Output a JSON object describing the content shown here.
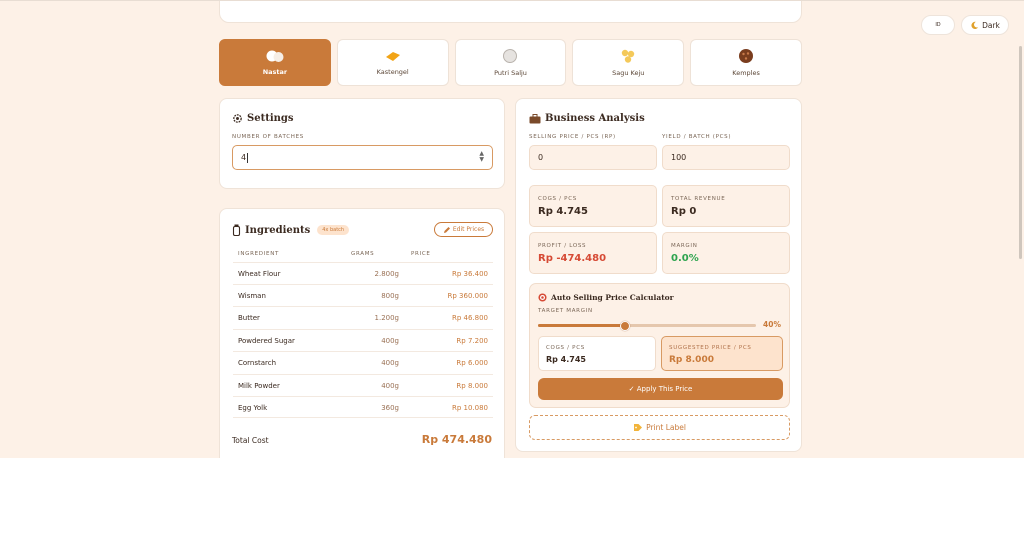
{
  "top_bar": {
    "lang_flag": "ID",
    "lang_label": "ID",
    "theme_label": "Dark"
  },
  "tabs": [
    {
      "label": "Nastar",
      "icon": "cloud-cookie-icon",
      "active": true
    },
    {
      "label": "Kastengel",
      "icon": "cheese-stick-icon",
      "active": false
    },
    {
      "label": "Putri Salju",
      "icon": "snow-ball-icon",
      "active": false
    },
    {
      "label": "Sagu Keju",
      "icon": "flower-cookie-icon",
      "active": false
    },
    {
      "label": "Kemples",
      "icon": "chocolate-cookie-icon",
      "active": false
    }
  ],
  "settings": {
    "title": "Settings",
    "batches_label": "NUMBER OF BATCHES",
    "batches_value": "4"
  },
  "ingredients": {
    "title": "Ingredients",
    "badge": "4x batch",
    "edit_label": "Edit Prices",
    "columns": [
      "INGREDIENT",
      "GRAMS",
      "PRICE"
    ],
    "rows": [
      {
        "name": "Wheat Flour",
        "grams": "2.800g",
        "price": "Rp 36.400"
      },
      {
        "name": "Wisman",
        "grams": "800g",
        "price": "Rp 360.000"
      },
      {
        "name": "Butter",
        "grams": "1.200g",
        "price": "Rp 46.800"
      },
      {
        "name": "Powdered Sugar",
        "grams": "400g",
        "price": "Rp 7.200"
      },
      {
        "name": "Cornstarch",
        "grams": "400g",
        "price": "Rp 6.000"
      },
      {
        "name": "Milk Powder",
        "grams": "400g",
        "price": "Rp 8.000"
      },
      {
        "name": "Egg Yolk",
        "grams": "360g",
        "price": "Rp 10.080"
      }
    ],
    "total_label": "Total Cost",
    "total_value": "Rp 474.480"
  },
  "analysis": {
    "title": "Business Analysis",
    "selling_label": "SELLING PRICE / PCS (RP)",
    "selling_value": "0",
    "yield_label": "YIELD / BATCH (PCS)",
    "yield_value": "100",
    "cogs_label": "COGS / PCS",
    "cogs_value": "Rp 4.745",
    "revenue_label": "TOTAL REVENUE",
    "revenue_value": "Rp 0",
    "profit_label": "PROFIT / LOSS",
    "profit_value": "Rp -474.480",
    "margin_label": "MARGIN",
    "margin_value": "0.0%",
    "colors": {
      "accent": "#c97a3a",
      "loss": "#d64a35",
      "gain": "#2ea44f"
    }
  },
  "calculator": {
    "title": "Auto Selling Price Calculator",
    "target_label": "TARGET MARGIN",
    "target_value": "40%",
    "target_fraction": 0.4,
    "cogs_label": "COGS / PCS",
    "cogs_value": "Rp 4.745",
    "suggested_label": "SUGGESTED PRICE / PCS",
    "suggested_value": "Rp 8.000",
    "apply_label": "✓ Apply This Price"
  },
  "print_label": "Print Label"
}
